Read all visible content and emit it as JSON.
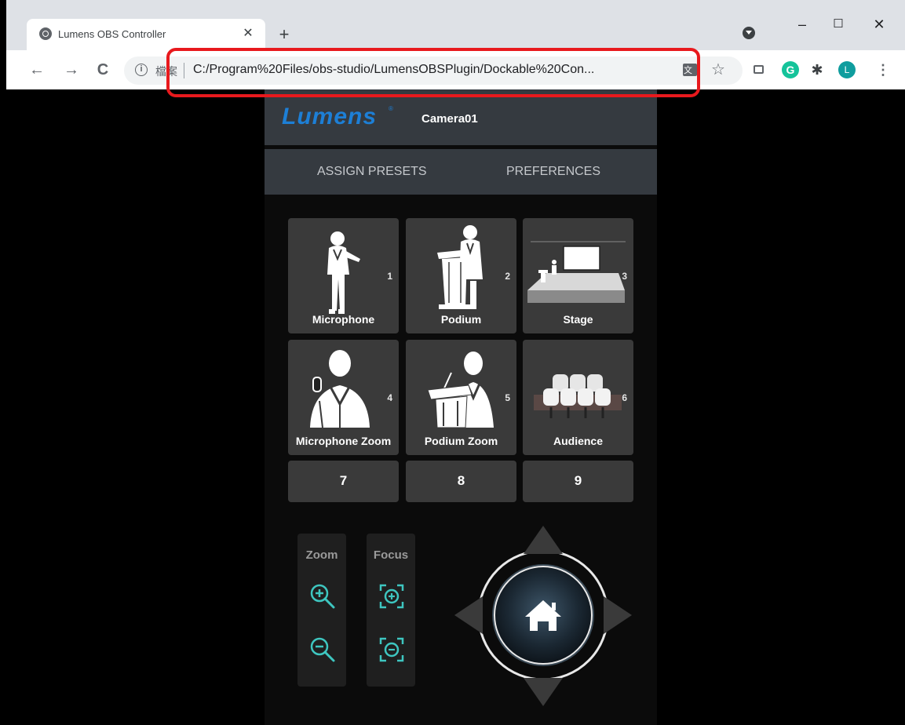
{
  "browser": {
    "tab_title": "Lumens OBS Controller",
    "tab_close": "✕",
    "new_tab": "+",
    "window_minimize": "–",
    "window_maximize": "☐",
    "window_close": "✕",
    "nav_back": "←",
    "nav_forward": "→",
    "nav_reload": "C",
    "scheme_label": "檔案",
    "url": "C:/Program%20Files/obs-studio/LumensOBSPlugin/Dockable%20Con...",
    "avatar_letter": "L",
    "grammarly_letter": "G",
    "extensions_icon": "✱",
    "menu_icon": "⋮",
    "info_glyph": "i",
    "star_glyph": "☆"
  },
  "header": {
    "logo": "Lumens",
    "logo_reg": "®",
    "camera_name": "Camera01"
  },
  "tabs": {
    "assign_presets": "ASSIGN PRESETS",
    "preferences": "PREFERENCES"
  },
  "presets": [
    {
      "num": "1",
      "label": "Microphone",
      "icon": "presenter-with-microphone-icon"
    },
    {
      "num": "2",
      "label": "Podium",
      "icon": "presenter-at-podium-icon"
    },
    {
      "num": "3",
      "label": "Stage",
      "icon": "stage-with-screen-icon"
    },
    {
      "num": "4",
      "label": "Microphone Zoom",
      "icon": "presenter-microphone-closeup-icon"
    },
    {
      "num": "5",
      "label": "Podium Zoom",
      "icon": "podium-closeup-icon"
    },
    {
      "num": "6",
      "label": "Audience",
      "icon": "audience-seats-icon"
    },
    {
      "num": "7"
    },
    {
      "num": "8"
    },
    {
      "num": "9"
    }
  ],
  "controls": {
    "zoom_label": "Zoom",
    "focus_label": "Focus",
    "zoom_in_icon": "zoom-in-icon",
    "zoom_out_icon": "zoom-out-icon",
    "focus_near_icon": "focus-plus-icon",
    "focus_far_icon": "focus-minus-icon",
    "home_icon": "home-icon"
  },
  "colors": {
    "accent_teal": "#3ec6c0",
    "logo_blue": "#1d7fd6",
    "highlight_red": "#e8191d"
  }
}
